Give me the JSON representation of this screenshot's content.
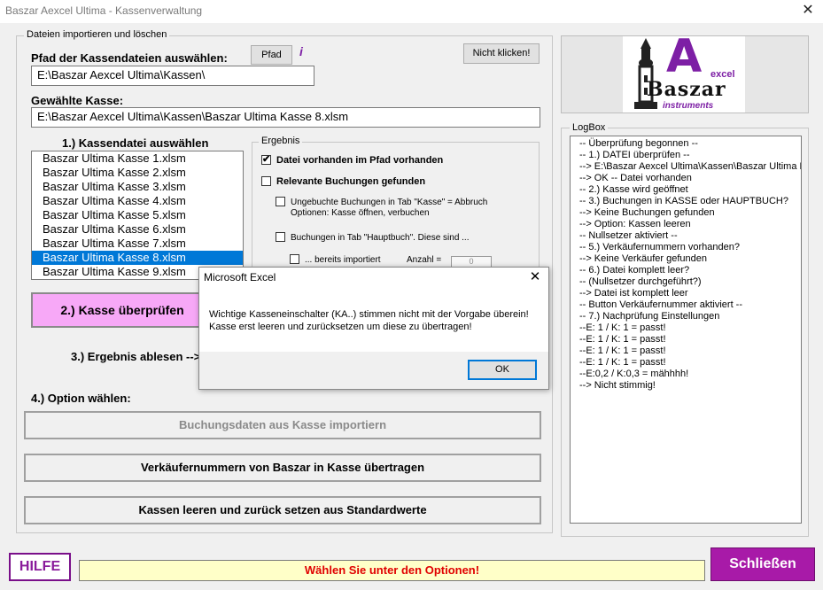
{
  "window": {
    "title": "Baszar Aexcel Ultima - Kassenverwaltung",
    "close_glyph": "✕"
  },
  "import_group": {
    "legend": "Dateien importieren und löschen",
    "path_label": "Pfad der Kassendateien auswählen:",
    "path_button": "Pfad",
    "info_glyph": "i",
    "path_value": "E:\\Baszar Aexcel Ultima\\Kassen\\",
    "dont_click_button": "Nicht klicken!",
    "selected_label": "Gewählte Kasse:",
    "selected_value": "E:\\Baszar Aexcel Ultima\\Kassen\\Baszar Ultima Kasse 8.xlsm",
    "step1_label": "1.) Kassendatei auswählen",
    "files": [
      "Baszar Ultima Kasse 1.xlsm",
      "Baszar Ultima Kasse 2.xlsm",
      "Baszar Ultima Kasse 3.xlsm",
      "Baszar Ultima Kasse 4.xlsm",
      "Baszar Ultima Kasse 5.xlsm",
      "Baszar Ultima Kasse 6.xlsm",
      "Baszar Ultima Kasse 7.xlsm",
      "Baszar Ultima Kasse 8.xlsm",
      "Baszar Ultima Kasse 9.xlsm"
    ],
    "selected_index": 7,
    "step2_button": "2.) Kasse überprüfen",
    "step3_label": "3.) Ergebnis ablesen -->",
    "step4_label": "4.) Option wählen:",
    "import_button": "Buchungsdaten aus Kasse importiern",
    "transfer_button": "Verkäufernummern von Baszar in Kasse übertragen",
    "reset_button": "Kassen leeren und zurück setzen aus Standardwerte"
  },
  "result_group": {
    "legend": "Ergebnis",
    "file_exists": "Datei vorhanden im Pfad vorhanden",
    "relevant_bookings": "Relevante Buchungen gefunden",
    "unbooked_line1": "Ungebuchte Buchungen in Tab \"Kasse\" = Abbruch",
    "unbooked_line2": "Optionen: Kasse öffnen, verbuchen",
    "hauptbuch": "Buchungen in Tab \"Hauptbuch\". Diese sind ...",
    "imported": "... bereits importiert",
    "count_label": "Anzahl =",
    "count_value": "0"
  },
  "logo": {
    "big_letter": "A",
    "small_text": "excel",
    "brand": "Baszar",
    "sub": "instruments",
    "colors": {
      "letter": "#7d1fa5",
      "brand": "#111111",
      "sub": "#7d1fa5"
    }
  },
  "logbox": {
    "legend": "LogBox",
    "lines": [
      "-- Überprüfung begonnen --",
      "-- 1.) DATEI überprüfen --",
      "--> E:\\Baszar Aexcel Ultima\\Kassen\\Baszar Ultima Ka",
      "--> OK -- Datei vorhanden",
      "-- 2.) Kasse wird geöffnet",
      "-- 3.) Buchungen in KASSE oder HAUPTBUCH?",
      "--> Keine Buchungen gefunden",
      "--> Option: Kassen leeren",
      "-- Nullsetzer aktiviert --",
      "-- 5.) Verkäufernummern vorhanden?",
      "--> Keine Verkäufer gefunden",
      "-- 6.) Datei komplett leer?",
      "-- (Nullsetzer durchgeführt?)",
      "--> Datei ist komplett leer",
      "-- Button Verkäufernummer aktiviert --",
      "-- 7.) Nachprüfung Einstellungen",
      "--E: 1 / K: 1 = passt!",
      "--E: 1 / K: 1 = passt!",
      "--E: 1 / K: 1 = passt!",
      "--E: 1 / K: 1 = passt!",
      "--E:0,2 / K:0,3 = mähhhh!",
      "--> Nicht stimmig!"
    ]
  },
  "dialog": {
    "title": "Microsoft Excel",
    "close_glyph": "✕",
    "message": "Wichtige Kasseneinschalter (KA..) stimmen nicht mit der Vorgabe überein! Kasse erst leeren und zurücksetzen um diese zu übertragen!",
    "ok_button": "OK"
  },
  "footer": {
    "help_button": "HILFE",
    "status_text": "Wählen Sie unter den Optionen!",
    "close_button": "Schließen"
  }
}
